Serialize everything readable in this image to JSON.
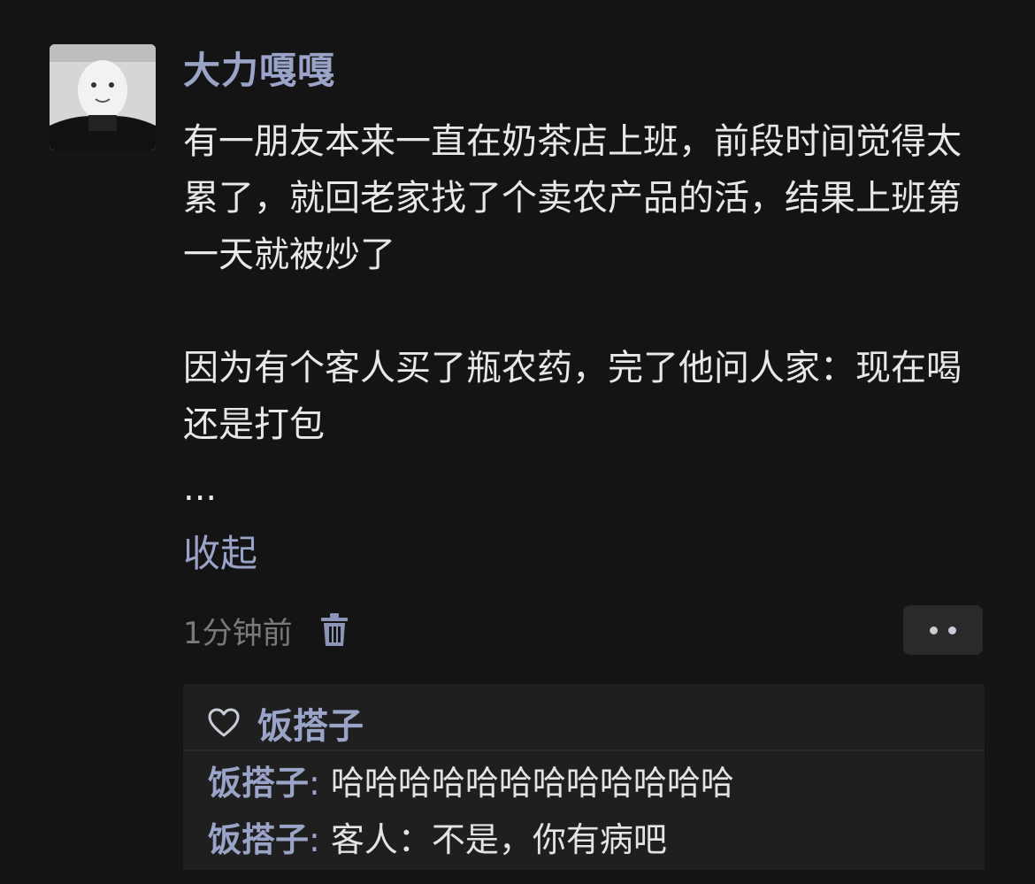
{
  "post": {
    "username": "大力嘎嘎",
    "content": {
      "paragraph_1": "有一朋友本来一直在奶茶店上班，前段时间觉得太累了，就回老家找了个卖农产品的活，结果上班第一天就被炒了",
      "paragraph_2": "因为有个客人买了瓶农药，完了他问人家：现在喝还是打包",
      "ellipsis": "..."
    },
    "collapse_label": "收起",
    "timestamp": "1分钟前",
    "icons": {
      "delete": "trash-icon",
      "more": "more-dots-icon",
      "like": "heart-outline-icon"
    }
  },
  "likes": {
    "users": "饭搭子"
  },
  "comments": [
    {
      "author": "饭搭子",
      "separator": ":",
      "text": " 哈哈哈哈哈哈哈哈哈哈哈哈"
    },
    {
      "author": "饭搭子",
      "separator": ":",
      "text": " 客人：不是，你有病吧"
    }
  ],
  "colors": {
    "background": "#141414",
    "link": "#9aa4c8",
    "text": "#e8e8e8",
    "muted": "#7a7a7a",
    "comment_panel": "#1f1f1f"
  }
}
